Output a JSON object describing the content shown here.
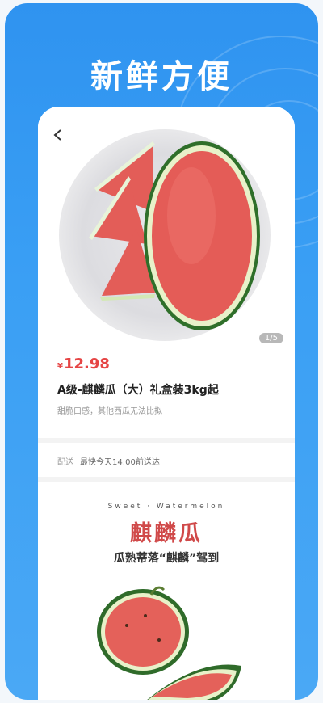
{
  "header": {
    "title": "新鲜方便"
  },
  "product": {
    "image_counter": "1/5",
    "currency_symbol": "¥",
    "price": "12.98",
    "title": "A级-麒麟瓜（大）礼盒装3kg起",
    "subtitle": "甜脆口感，其他西瓜无法比拟"
  },
  "delivery": {
    "label": "配送",
    "value": "最快今天14:00前送达"
  },
  "banner": {
    "subtitle_en": "Sweet · Watermelon",
    "title": "麒麟瓜",
    "tagline": "瓜熟蒂落“麒麟”驾到"
  },
  "colors": {
    "background": "#3a9ff4",
    "price": "#e64545",
    "banner_title": "#d04949"
  }
}
